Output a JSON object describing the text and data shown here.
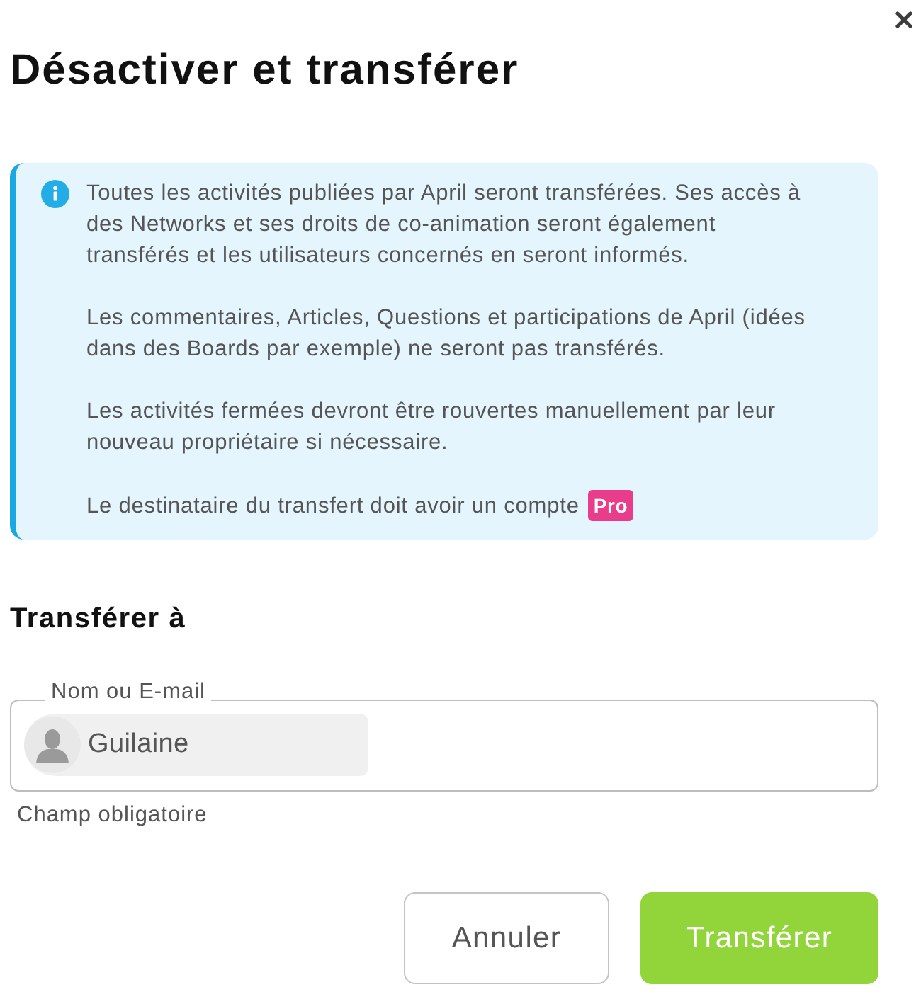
{
  "dialog": {
    "title": "Désactiver et transférer"
  },
  "notice": {
    "paragraphs": [
      {
        "text": "Toutes les activités publiées par April seront transférées. Ses accès à des Networks et ses droits de co-animation seront également transférés et les utilisateurs concernés en seront informés."
      },
      {
        "text": "Les commentaires, Articles, Questions et participations de April (idées dans des Boards par exemple) ne seront pas transférés."
      },
      {
        "text": "Les activités fermées devront être rouvertes manuellement par leur nouveau propriétaire si nécessaire."
      },
      {
        "text": "Le destinataire du transfert doit avoir un compte",
        "badge": "Pro"
      }
    ]
  },
  "section": {
    "heading": "Transférer à"
  },
  "field": {
    "label": "Nom ou E-mail",
    "chips": [
      {
        "name": "Guilaine"
      }
    ],
    "helper": "Champ obligatoire"
  },
  "buttons": [
    {
      "label": "Annuler",
      "kind": "secondary"
    },
    {
      "label": "Transférer",
      "kind": "primary"
    }
  ]
}
